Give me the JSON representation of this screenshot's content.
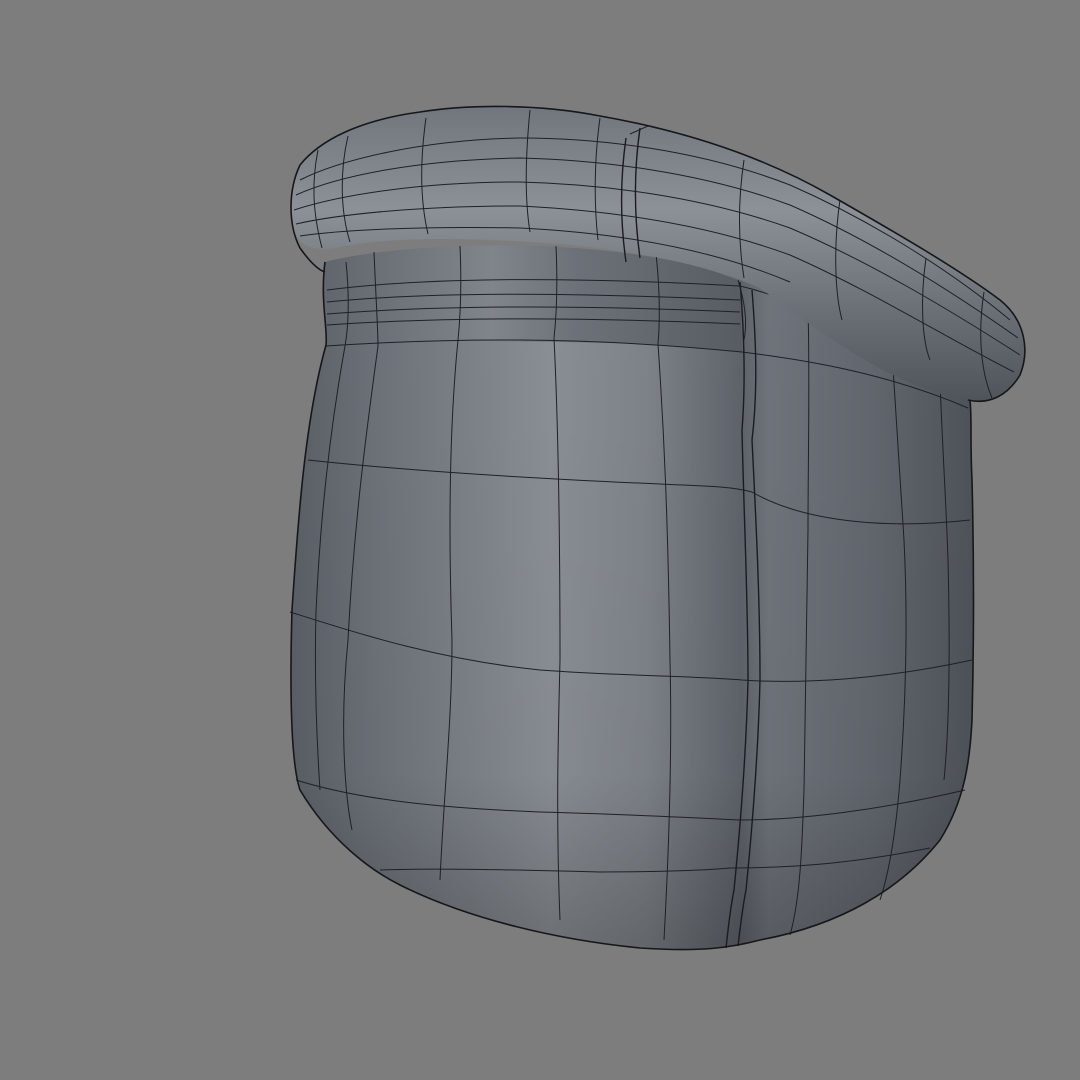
{
  "viewport": {
    "background_color": "#7d7d7d",
    "object": "sack-mesh",
    "display_mode": "shaded-wireframe",
    "mesh_base_color": "#6f747b",
    "wire_color": "#1e2124"
  }
}
